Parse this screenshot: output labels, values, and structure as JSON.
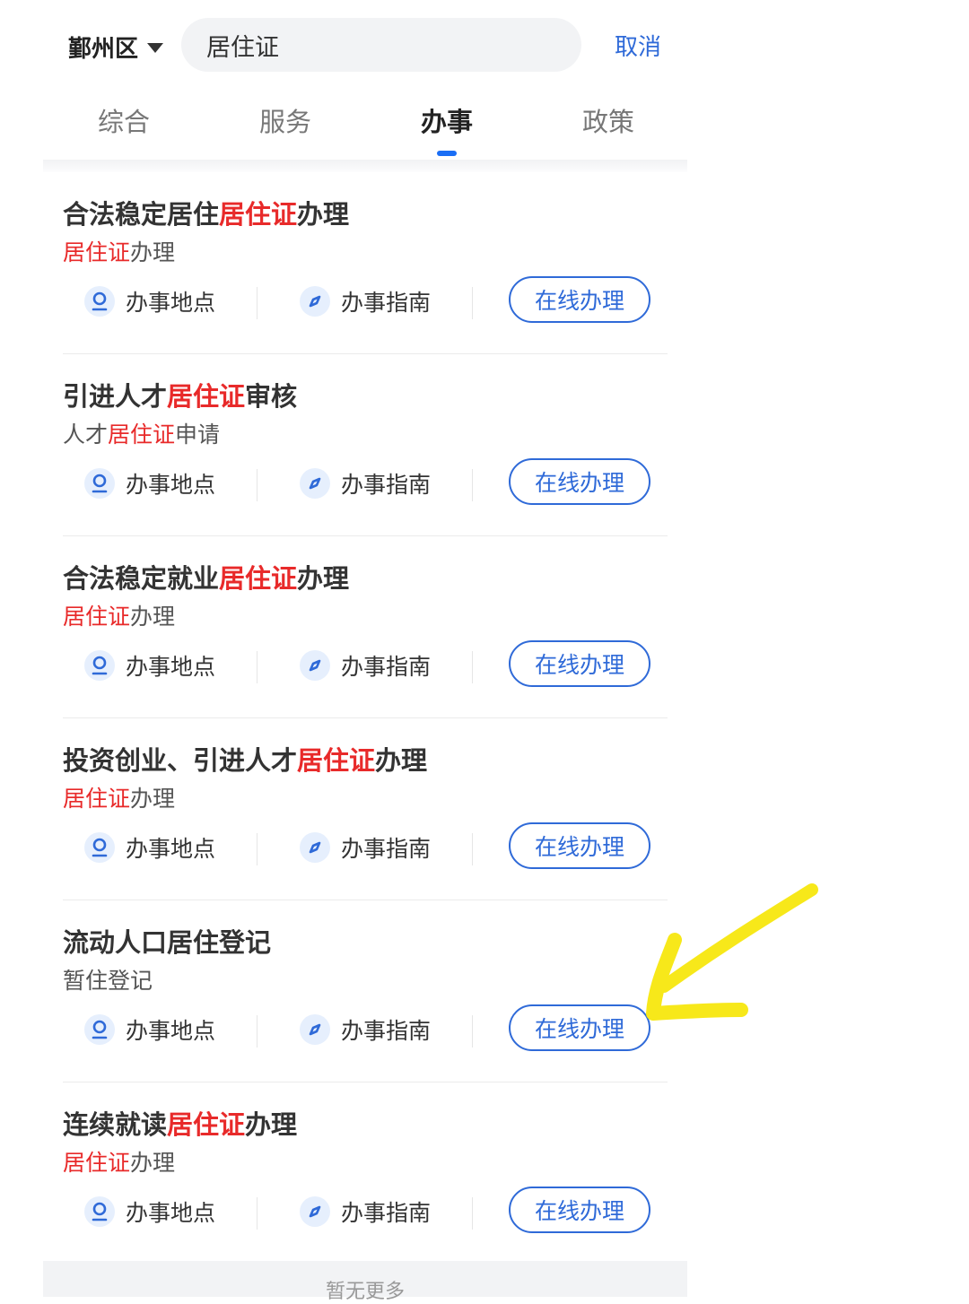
{
  "header": {
    "region": "鄞州区",
    "search_value": "居住证",
    "cancel": "取消"
  },
  "tabs": [
    {
      "label": "综合"
    },
    {
      "label": "服务"
    },
    {
      "label": "办事",
      "active": true
    },
    {
      "label": "政策"
    }
  ],
  "items": [
    {
      "title_pre": "合法稳定居住",
      "title_hl": "居住证",
      "title_post": "办理",
      "sub_pre": "",
      "sub_hl": "居住证",
      "sub_post": "办理",
      "loc": "办事地点",
      "guide": "办事指南",
      "online": "在线办理"
    },
    {
      "title_pre": "引进人才",
      "title_hl": "居住证",
      "title_post": "审核",
      "sub_pre": "人才",
      "sub_hl": "居住证",
      "sub_post": "申请",
      "loc": "办事地点",
      "guide": "办事指南",
      "online": "在线办理"
    },
    {
      "title_pre": "合法稳定就业",
      "title_hl": "居住证",
      "title_post": "办理",
      "sub_pre": "",
      "sub_hl": "居住证",
      "sub_post": "办理",
      "loc": "办事地点",
      "guide": "办事指南",
      "online": "在线办理"
    },
    {
      "title_pre": "投资创业、引进人才",
      "title_hl": "居住证",
      "title_post": "办理",
      "sub_pre": "",
      "sub_hl": "居住证",
      "sub_post": "办理",
      "loc": "办事地点",
      "guide": "办事指南",
      "online": "在线办理"
    },
    {
      "title_pre": "流动人口居住登记",
      "title_hl": "",
      "title_post": "",
      "sub_pre": "暂住登记",
      "sub_hl": "",
      "sub_post": "",
      "loc": "办事地点",
      "guide": "办事指南",
      "online": "在线办理"
    },
    {
      "title_pre": "连续就读",
      "title_hl": "居住证",
      "title_post": "办理",
      "sub_pre": "",
      "sub_hl": "居住证",
      "sub_post": "办理",
      "loc": "办事地点",
      "guide": "办事指南",
      "online": "在线办理"
    }
  ],
  "footer": {
    "more": "暂无更多"
  },
  "colors": {
    "accent": "#2f6ad8",
    "highlight": "#e82a2a",
    "annotation": "#f7e81a"
  }
}
